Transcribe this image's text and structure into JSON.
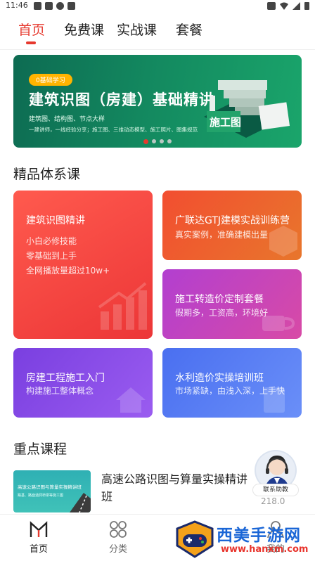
{
  "status_bar": {
    "time": "11:46"
  },
  "tabs": [
    {
      "label": "首页",
      "active": true
    },
    {
      "label": "免费课",
      "active": false
    },
    {
      "label": "实战课",
      "active": false
    },
    {
      "label": "套餐",
      "active": false
    }
  ],
  "banner": {
    "pill": "0基础学习",
    "title": "建筑识图（房建）基础精讲",
    "line1": "建筑图、结构图、节点大样",
    "line2": "一建讲师，一线经验分享；施工图、三维动态模型、施工照片、图集规范",
    "art_text": "施工图",
    "active_dot": 1,
    "dot_count": 4
  },
  "section_premium": {
    "title": "精品体系课"
  },
  "cards": {
    "c1": {
      "title": "建筑识图精讲",
      "lines": [
        "小白必修技能",
        "零基础到上手",
        "全网播放量超过10w+"
      ]
    },
    "c2": {
      "title": "广联达GTJ建模实战训练营",
      "sub": "真实案例，准确建模出量"
    },
    "c3": {
      "title": "施工转造价定制套餐",
      "sub": "假期多，工资高，环境好"
    },
    "c4": {
      "title": "房建工程施工入门",
      "sub": "构建施工整体概念"
    },
    "c5": {
      "title": "水利造价实操培训班",
      "sub": "市场紧缺，由浅入深，上手快"
    }
  },
  "section_key": {
    "title": "重点课程"
  },
  "course": {
    "thumb_title": "高速公路识图与算量实操精讲班",
    "thumb_sub": "路基、路面涵洞桥梁等施工图",
    "title": "高速公路识图与算量实操精讲班"
  },
  "contact": {
    "label": "联系助教",
    "price": "218.0"
  },
  "bottom_nav": [
    {
      "label": "首页",
      "active": true,
      "icon": "home-icon"
    },
    {
      "label": "分类",
      "active": false,
      "icon": "category-icon"
    },
    {
      "label": "我的",
      "active": false,
      "icon": "profile-icon"
    }
  ],
  "watermark": {
    "brand": "西美手游网",
    "url": "www.hanxm.com"
  },
  "colors": {
    "accent": "#e6392e",
    "banner": "#13885f"
  }
}
